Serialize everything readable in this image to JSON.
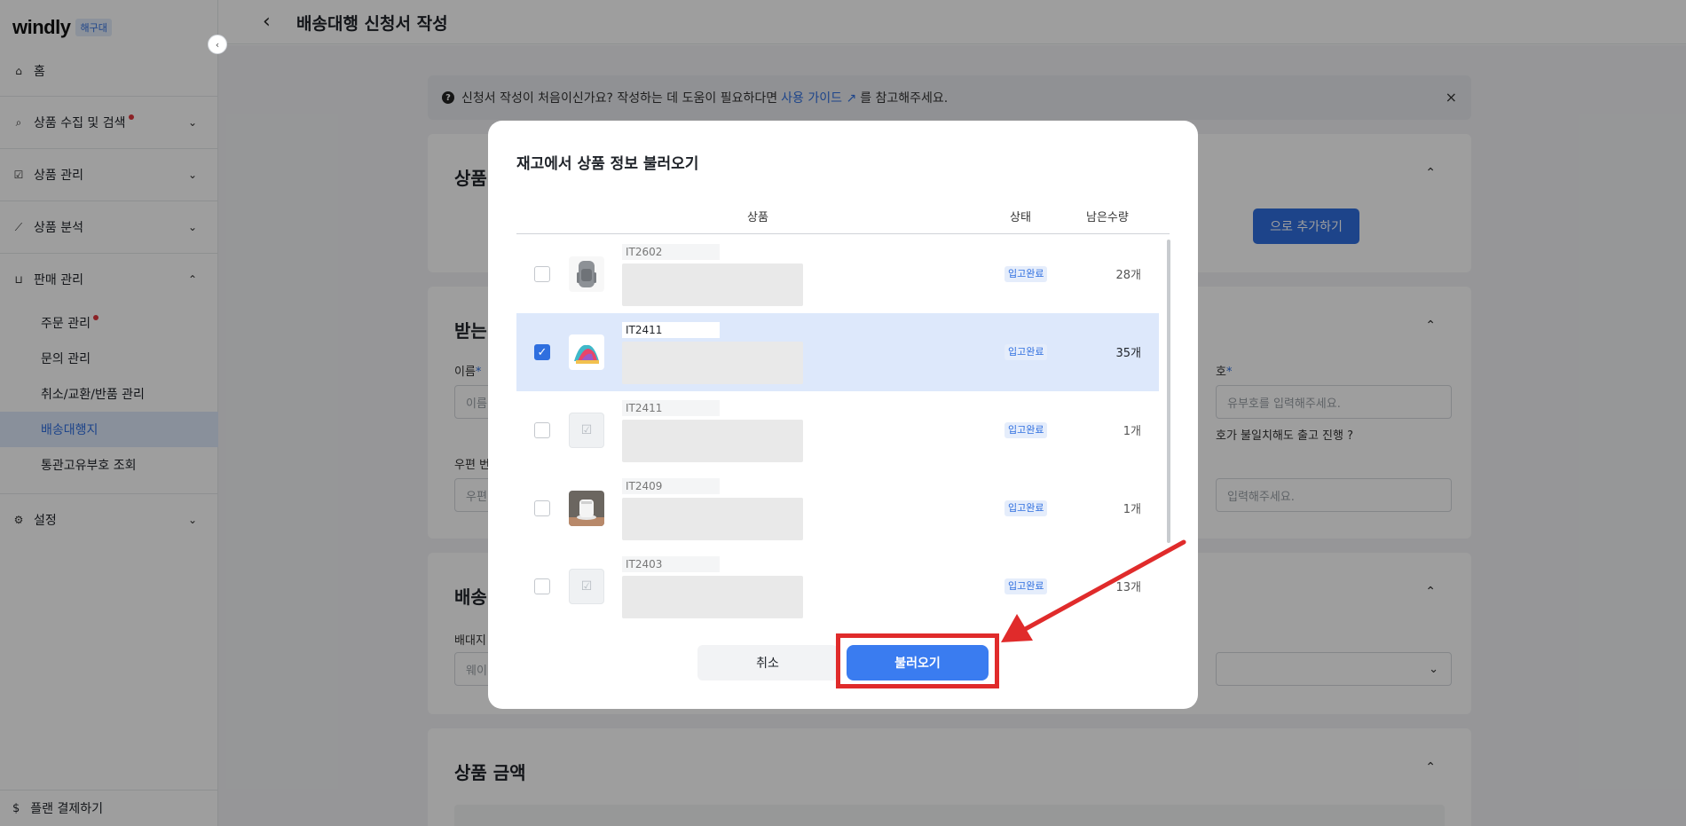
{
  "sidebar": {
    "logo": "windly",
    "logo_badge": "해구대",
    "items": [
      {
        "label": "홈"
      },
      {
        "label": "상품 수집 및 검색"
      },
      {
        "label": "상품 관리"
      },
      {
        "label": "상품 분석"
      },
      {
        "label": "판매 관리"
      },
      {
        "label": "설정"
      }
    ],
    "sub_items": [
      {
        "label": "주문 관리"
      },
      {
        "label": "문의 관리"
      },
      {
        "label": "취소/교환/반품 관리"
      },
      {
        "label": "배송대행지"
      },
      {
        "label": "통관고유부호 조회"
      }
    ],
    "plan_label": "플랜 결제하기"
  },
  "header": {
    "title": "배송대행 신청서 작성"
  },
  "main": {
    "info_text_before": "신청서 작성이 처음이신가요? 작성하는 데 도움이 필요하다면",
    "info_link": "사용 가이드",
    "info_text_after": "를 참고해주세요.",
    "card1_title": "상품",
    "add_button_text": "으로 추가하기",
    "card2_title": "받는",
    "name_label": "이름",
    "name_placeholder": "이름",
    "code_label": "호",
    "code_placeholder": "유부호를 입력해주세요.",
    "code_note": "호가 불일치해도 출고 진행",
    "zip_label": "우편 번",
    "zip_placeholder": "우편",
    "addr_placeholder": "입력해주세요.",
    "card3_title": "배송",
    "dest_label": "배대지",
    "dest_placeholder": "웨이",
    "card4_title": "상품 금액"
  },
  "modal": {
    "title": "재고에서 상품 정보 불러오기",
    "columns": {
      "product": "상품",
      "status": "상태",
      "qty": "남은수량"
    },
    "rows": [
      {
        "code": "IT2602",
        "status": "입고완료",
        "qty": "28개",
        "checked": false
      },
      {
        "code": "IT2411",
        "status": "입고완료",
        "qty": "35개",
        "checked": true
      },
      {
        "code": "IT2411",
        "status": "입고완료",
        "qty": "1개",
        "checked": false
      },
      {
        "code": "IT2409",
        "status": "입고완료",
        "qty": "1개",
        "checked": false
      },
      {
        "code": "IT2403",
        "status": "입고완료",
        "qty": "13개",
        "checked": false
      }
    ],
    "cancel_label": "취소",
    "load_label": "불러오기"
  },
  "colors": {
    "accent": "#2f6fdf",
    "highlight": "#e02b2b",
    "badge_bg": "#e5edfb"
  }
}
